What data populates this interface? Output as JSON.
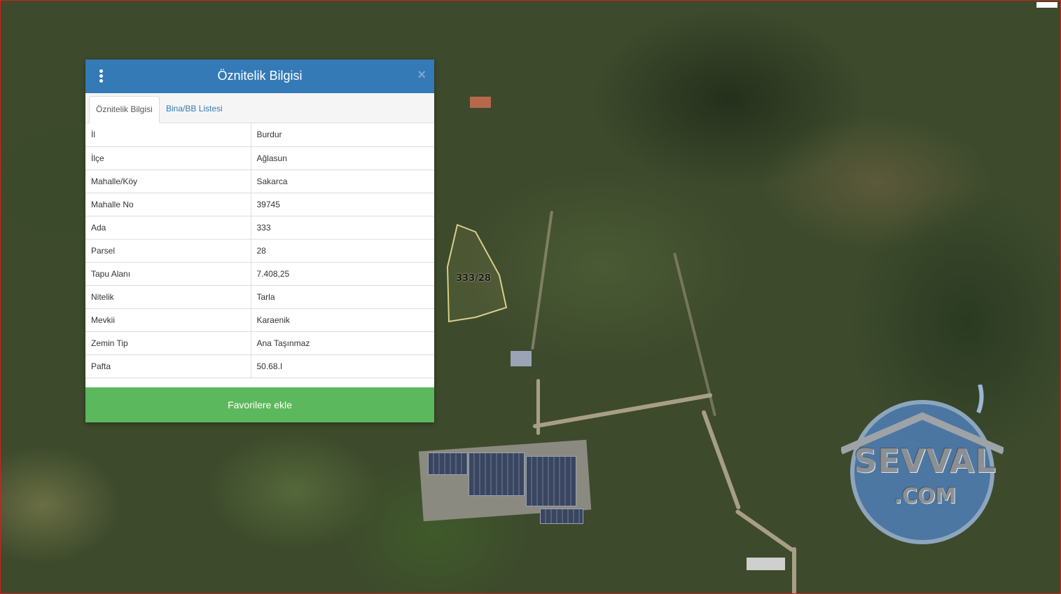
{
  "panel": {
    "title": "Öznitelik Bilgisi",
    "menu_icon": "vertical-dots-icon",
    "close_icon": "close-icon",
    "close_label": "×",
    "tabs": [
      {
        "label": "Öznitelik Bilgisi",
        "active": true
      },
      {
        "label": "Bina/BB Listesi",
        "active": false
      }
    ],
    "rows": [
      {
        "key": "İl",
        "value": "Burdur"
      },
      {
        "key": "İlçe",
        "value": "Ağlasun"
      },
      {
        "key": "Mahalle/Köy",
        "value": "Sakarca"
      },
      {
        "key": "Mahalle No",
        "value": "39745"
      },
      {
        "key": "Ada",
        "value": "333"
      },
      {
        "key": "Parsel",
        "value": "28"
      },
      {
        "key": "Tapu Alanı",
        "value": "7.408,25"
      },
      {
        "key": "Nitelik",
        "value": "Tarla"
      },
      {
        "key": "Mevkii",
        "value": "Karaenik"
      },
      {
        "key": "Zemin Tip",
        "value": "Ana Taşınmaz"
      },
      {
        "key": "Pafta",
        "value": "50.68.I"
      }
    ],
    "favorite_button": "Favorilere ekle"
  },
  "map": {
    "parcel_label": "333/28",
    "watermark_main": "SEVVAL",
    "watermark_sub": ".COM"
  },
  "colors": {
    "header": "#337ab7",
    "button": "#5cb85c",
    "tab_link": "#337ab7",
    "parcel_outline": "#d8cf8a"
  }
}
